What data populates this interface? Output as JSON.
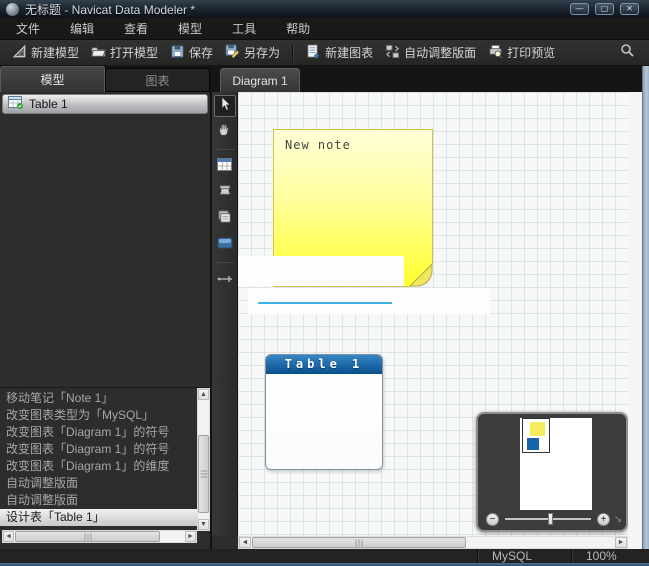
{
  "window": {
    "title": "无标题 - Navicat Data Modeler *",
    "controls": {
      "minimize": "—",
      "maximize": "▢",
      "close": "✕"
    }
  },
  "menu": {
    "items": [
      "文件",
      "编辑",
      "查看",
      "模型",
      "工具",
      "帮助"
    ]
  },
  "toolbar": {
    "new_model": "新建模型",
    "open_model": "打开模型",
    "save": "保存",
    "save_as": "另存为",
    "new_diagram": "新建图表",
    "auto_layout": "自动调整版面",
    "print_preview": "打印预览"
  },
  "left_panel": {
    "tabs": {
      "model": "模型",
      "diagram": "图表"
    },
    "model_tree": {
      "table_item": "Table 1"
    },
    "history": {
      "items": [
        "移动笔记「Note 1」",
        "改变图表类型为「MySQL」",
        "改变图表「Diagram 1」的符号",
        "改变图表「Diagram 1」的符号",
        "改变图表「Diagram 1」的维度",
        "自动调整版面",
        "自动调整版面",
        "设计表「Table 1」"
      ],
      "selected_index": 7
    }
  },
  "diagram": {
    "tab_label": "Diagram 1",
    "note": {
      "text": "New note",
      "color_top": "#ffffd9",
      "color_bottom": "#ffff2d"
    },
    "table": {
      "title": "Table 1",
      "header_color": "#11599a"
    }
  },
  "overview": {
    "zoom_out": "−",
    "zoom_in": "+",
    "resize_glyph": "↘"
  },
  "status_bar": {
    "db_type": "MySQL",
    "zoom_level": "100%"
  }
}
